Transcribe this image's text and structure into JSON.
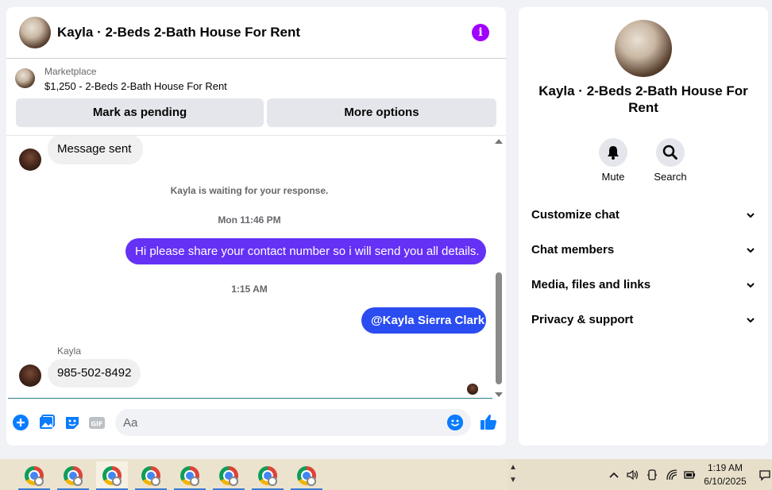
{
  "chat": {
    "header_title": "Kayla · 2-Beds 2-Bath House For Rent",
    "marketplace_label": "Marketplace",
    "listing_title": "$1,250 - 2-Beds 2-Bath House For Rent",
    "mark_pending_label": "Mark as pending",
    "more_options_label": "More options",
    "messages": {
      "m1": "Message sent",
      "waiting": "Kayla is waiting for your response.",
      "time1": "Mon 11:46 PM",
      "m2": "Hi please share your contact number so i will send you all details.",
      "time2": "1:15 AM",
      "m3": "@Kayla Sierra Clark",
      "sender_name": "Kayla",
      "m4": "985-502-8492"
    },
    "composer_placeholder": "Aa",
    "colors": {
      "accent": "#0a7cff",
      "outgoing_purple": "#6531f5",
      "outgoing_blue": "#2a4cf0",
      "info": "#a100ff"
    }
  },
  "info": {
    "title": "Kayla · 2-Beds 2-Bath House For Rent",
    "mute_label": "Mute",
    "search_label": "Search",
    "sections": [
      "Customize chat",
      "Chat members",
      "Media, files and links",
      "Privacy & support"
    ]
  },
  "taskbar": {
    "time": "1:19 AM",
    "date": "6/10/2025"
  }
}
